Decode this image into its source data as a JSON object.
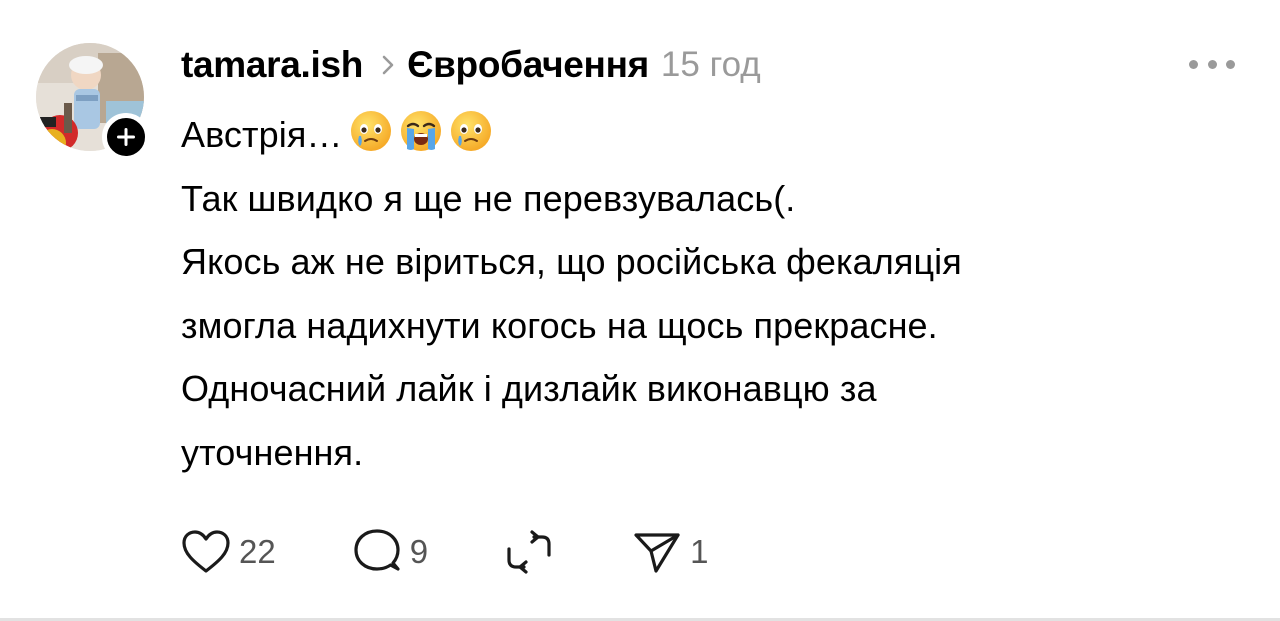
{
  "post": {
    "username": "tamara.ish",
    "community": "Євробачення",
    "timestamp": "15 год",
    "avatar_icon": "profile-photo",
    "follow_icon": "plus-icon",
    "more_icon": "more-horizontal-icon",
    "text_lines": [
      "Австрія…",
      "Так швидко я ще не перевзувалась(.",
      "Якось аж не віриться, що російська фекаляція",
      "змогла надихнути когось на щось прекрасне.",
      "Одночасний лайк і дизлайк виконавцю за",
      "уточнення."
    ],
    "emojis": [
      "face-holding-back-tears",
      "loudly-crying-face",
      "face-holding-back-tears"
    ]
  },
  "actions": {
    "likes": "22",
    "replies": "9",
    "reposts_icon": "repost-icon",
    "shares": "1"
  },
  "colors": {
    "text": "#000000",
    "secondary": "#9a9a9a",
    "count": "#555555",
    "divider": "#e2e2e2"
  }
}
